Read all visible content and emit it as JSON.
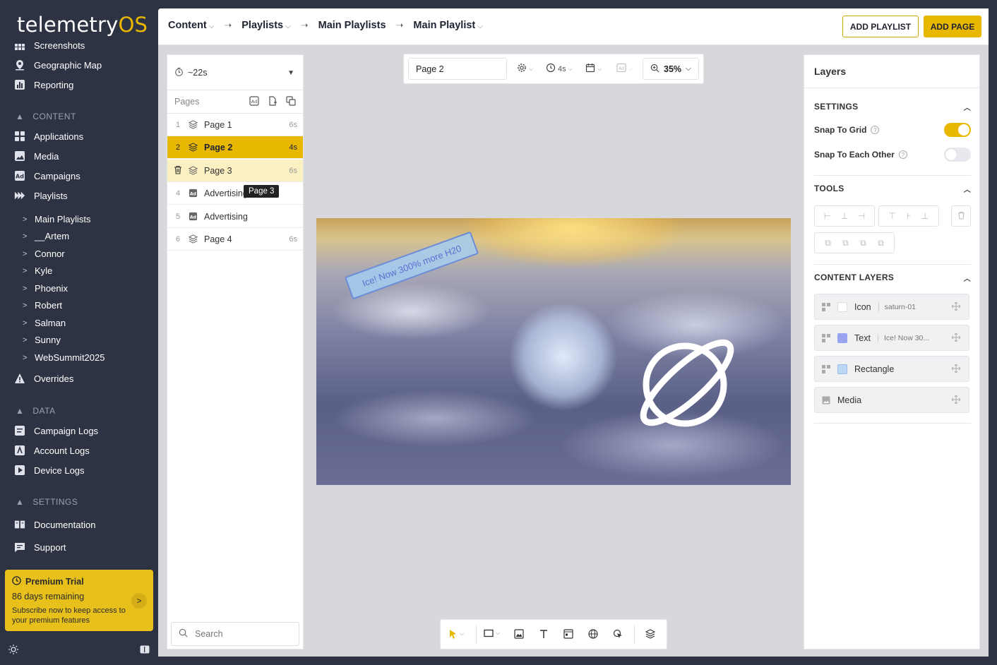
{
  "brand": {
    "name_main": "telemetry",
    "name_accent": "OS",
    "accent_color": "#e8b800"
  },
  "sidebar": {
    "top_items": [
      {
        "label": "Screenshots",
        "icon": "grid-icon"
      },
      {
        "label": "Geographic Map",
        "icon": "map-pin-icon"
      },
      {
        "label": "Reporting",
        "icon": "chart-icon"
      }
    ],
    "content_section": "CONTENT",
    "content_items": [
      {
        "label": "Applications",
        "icon": "apps-icon"
      },
      {
        "label": "Media",
        "icon": "image-icon"
      },
      {
        "label": "Campaigns",
        "icon": "ad-icon"
      },
      {
        "label": "Playlists",
        "icon": "playlist-icon"
      }
    ],
    "playlist_children": [
      "Main Playlists",
      "__Artem",
      "Connor",
      "Kyle",
      "Phoenix",
      "Robert",
      "Salman",
      "Sunny",
      "WebSummit2025"
    ],
    "overrides": "Overrides",
    "data_section": "DATA",
    "data_items": [
      "Campaign Logs",
      "Account Logs",
      "Device Logs"
    ],
    "settings_section": "SETTINGS",
    "settings_items": [
      "Documentation",
      "Support"
    ],
    "trial": {
      "title": "Premium Trial",
      "days": "86 days remaining",
      "message": "Subscribe now to keep access to your premium features"
    }
  },
  "header": {
    "breadcrumbs": [
      "Content",
      "Playlists",
      "Main Playlists",
      "Main Playlist"
    ],
    "add_playlist": "ADD PLAYLIST",
    "add_page": "ADD PAGE"
  },
  "pages_panel": {
    "duration": "~22s",
    "header": "Pages",
    "rows": [
      {
        "num": "1",
        "label": "Page 1",
        "dur": "6s",
        "type": "layers"
      },
      {
        "num": "2",
        "label": "Page 2",
        "dur": "4s",
        "type": "layers"
      },
      {
        "num": "",
        "label": "Page 3",
        "dur": "6s",
        "type": "layers"
      },
      {
        "num": "4",
        "label": "Advertising",
        "dur": "",
        "type": "ad"
      },
      {
        "num": "5",
        "label": "Advertising",
        "dur": "",
        "type": "ad"
      },
      {
        "num": "6",
        "label": "Page 4",
        "dur": "6s",
        "type": "layers"
      }
    ],
    "tooltip": "Page 3",
    "search_placeholder": "Search"
  },
  "page_toolbar": {
    "page_name": "Page 2",
    "duration": "4s",
    "zoom": "35%"
  },
  "canvas": {
    "banner_text": "Ice! Now 300% more H20"
  },
  "layers_panel": {
    "title": "Layers",
    "settings_title": "SETTINGS",
    "snap_grid": {
      "label": "Snap To Grid",
      "on": true
    },
    "snap_each": {
      "label": "Snap To Each Other",
      "on": false
    },
    "tools_title": "TOOLS",
    "content_layers_title": "CONTENT LAYERS",
    "layers": [
      {
        "label": "Icon",
        "extra": "saturn-01",
        "swatch": "#ffffff"
      },
      {
        "label": "Text",
        "extra": "Ice! Now 30...",
        "swatch": "#9aa3ef"
      },
      {
        "label": "Rectangle",
        "extra": "",
        "swatch": "#bcd8f5"
      },
      {
        "label": "Media",
        "extra": "",
        "swatch": ""
      }
    ]
  }
}
